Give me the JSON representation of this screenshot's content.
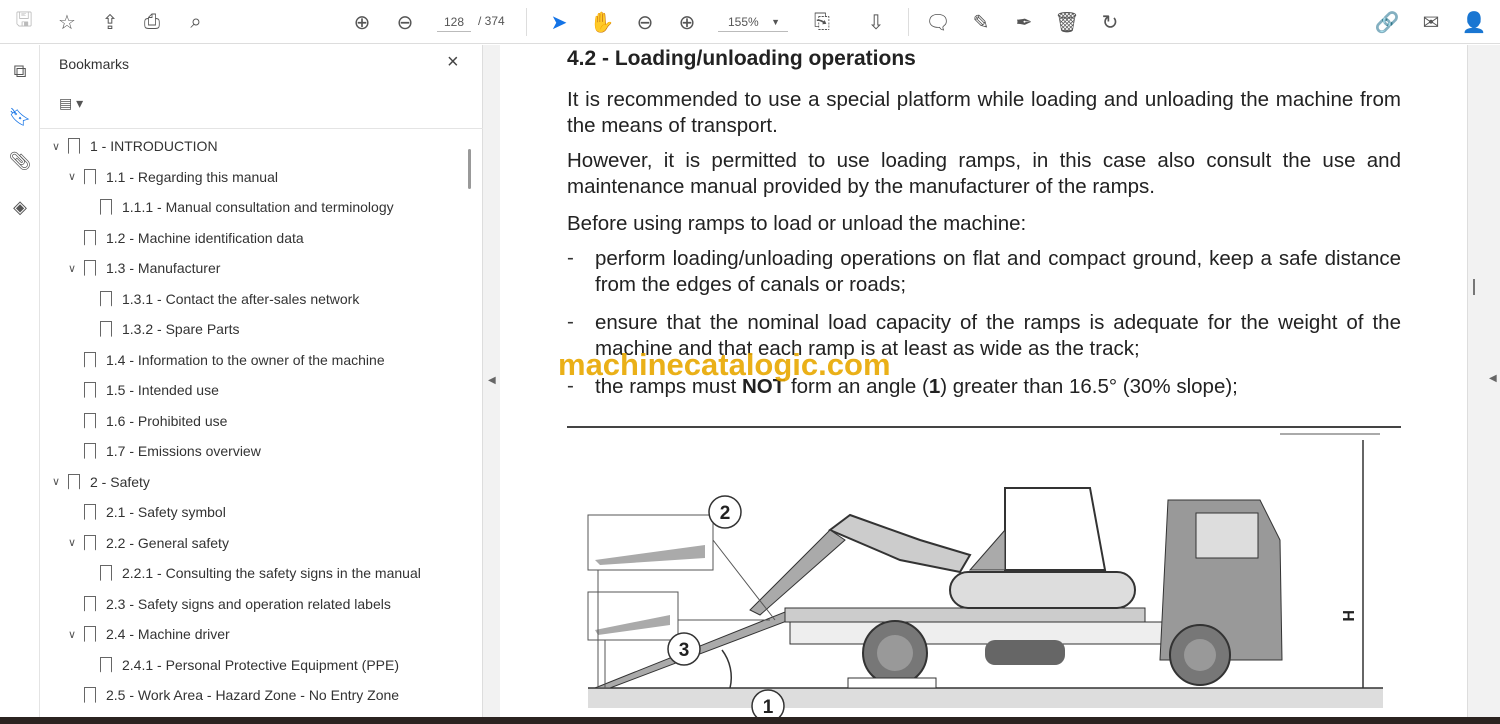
{
  "toolbar": {
    "page_current": "128",
    "page_total": "/ 374",
    "zoom": "155%",
    "icons_left": [
      "save-icon",
      "star-icon",
      "cloud-upload-icon",
      "print-icon",
      "find-icon"
    ],
    "icons_nav": [
      "page-up-icon",
      "page-down-icon"
    ],
    "icons_tools": [
      "select-cursor-icon",
      "hand-icon",
      "zoom-out-icon",
      "zoom-in-icon"
    ],
    "icons_right": [
      "fit-page-icon",
      "scroll-mode-icon",
      "comment-icon",
      "highlight-icon",
      "sign-icon",
      "delete-icon",
      "rotate-icon",
      "share-link-icon",
      "email-icon",
      "add-user-icon"
    ],
    "accent": "#1473e6"
  },
  "rail": [
    "pages-icon",
    "bookmarks-icon",
    "attachments-icon",
    "layers-icon"
  ],
  "bookmarks": {
    "title": "Bookmarks",
    "close": "×",
    "items": [
      {
        "label": "1  -  INTRODUCTION",
        "level": 0,
        "expanded": true
      },
      {
        "label": "1.1 - Regarding this manual",
        "level": 1,
        "expanded": true
      },
      {
        "label": "1.1.1 - Manual consultation and terminology",
        "level": 2
      },
      {
        "label": "1.2 - Machine identification data",
        "level": 1
      },
      {
        "label": "1.3 - Manufacturer",
        "level": 1,
        "expanded": true
      },
      {
        "label": "1.3.1 - Contact the after-sales network",
        "level": 2
      },
      {
        "label": "1.3.2 - Spare Parts",
        "level": 2
      },
      {
        "label": "1.4 - Information to the owner of the machine",
        "level": 1
      },
      {
        "label": "1.5 - Intended use",
        "level": 1
      },
      {
        "label": "1.6 - Prohibited use",
        "level": 1
      },
      {
        "label": "1.7 - Emissions overview",
        "level": 1
      },
      {
        "label": "2  -  Safety",
        "level": 0,
        "expanded": true
      },
      {
        "label": "2.1 - Safety symbol",
        "level": 1
      },
      {
        "label": "2.2 - General safety",
        "level": 1,
        "expanded": true
      },
      {
        "label": "2.2.1 - Consulting the safety signs in the manual",
        "level": 2
      },
      {
        "label": "2.3 - Safety signs and operation related labels",
        "level": 1
      },
      {
        "label": "2.4 - Machine driver",
        "level": 1,
        "expanded": true
      },
      {
        "label": "2.4.1 - Personal Protective Equipment (PPE)",
        "level": 2
      },
      {
        "label": "2.5 - Work Area - Hazard Zone - No Entry Zone",
        "level": 1
      }
    ]
  },
  "document": {
    "heading": "4.2 - Loading/unloading operations",
    "p1": "It is recommended to use a special platform while loading and unloading the machine from the means of transport.",
    "p2": "However, it is permitted to use loading ramps, in this case also consult the use and maintenance manual provided by the manufacturer of the ramps.",
    "p3": "Before using ramps to load or unload the machine:",
    "bullets": [
      "perform loading/unloading operations on flat and compact ground, keep a safe distance from the edges of canals or roads;",
      "ensure that the nominal load capacity of the ramps is adequate for the weight of the machine and that each ramp is at least as wide as the track;"
    ],
    "b3_pre": "the ramps must ",
    "b3_bold": "NOT",
    "b3_mid": " form an angle (",
    "b3_num": "1",
    "b3_post": ") greater than 16.5° (30% slope);",
    "dash": "-",
    "figure_labels": {
      "l1": "1",
      "l2": "2",
      "l3": "3",
      "h": "H"
    },
    "watermark": "machinecatalogic.com"
  }
}
